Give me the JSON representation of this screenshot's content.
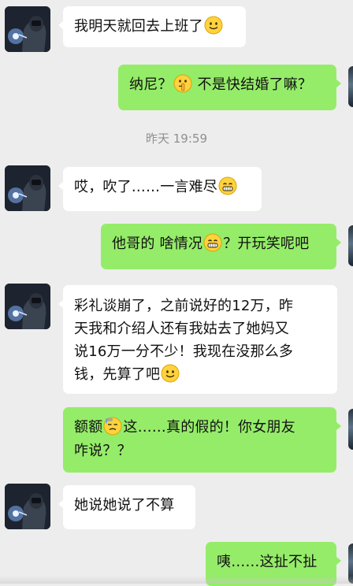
{
  "timestamp": "昨天 19:59",
  "messages": [
    {
      "side": "in",
      "parts": [
        "我明天就回去上班了",
        ""
      ]
    },
    {
      "side": "out",
      "parts": [
        "纳尼？",
        " 不是快结婚了嘛？"
      ]
    },
    {
      "side": "in",
      "parts": [
        "哎，吹了……一言难尽",
        ""
      ]
    },
    {
      "side": "out",
      "parts": [
        "他哥的 啥情况",
        "？开玩笑呢吧"
      ]
    },
    {
      "side": "in",
      "lines": [
        "彩礼谈崩了，之前说好的12万，昨",
        "天我和介绍人还有我姑去了她妈又",
        "说16万一分不少！我现在没那么多"
      ],
      "last_line": "钱，先算了吧"
    },
    {
      "side": "out",
      "lines_pre": "额额",
      "line1_post": "这……真的假的！你女朋友",
      "line2": "咋说？？"
    },
    {
      "side": "in",
      "parts": [
        "她说她说了不算"
      ]
    },
    {
      "side": "out",
      "parts": [
        "咦……这扯不扯"
      ]
    }
  ],
  "emojis": {
    "m1": "smile-emoji",
    "m2": "shush-emoji",
    "m3": "grin-emoji",
    "m4": "grin-emoji",
    "m5": "smile-emoji",
    "m6": "sweat-emoji"
  },
  "colors": {
    "background": "#ededed",
    "incoming_bubble": "#ffffff",
    "outgoing_bubble": "#95ec69",
    "timestamp_text": "#8f8f8f"
  }
}
